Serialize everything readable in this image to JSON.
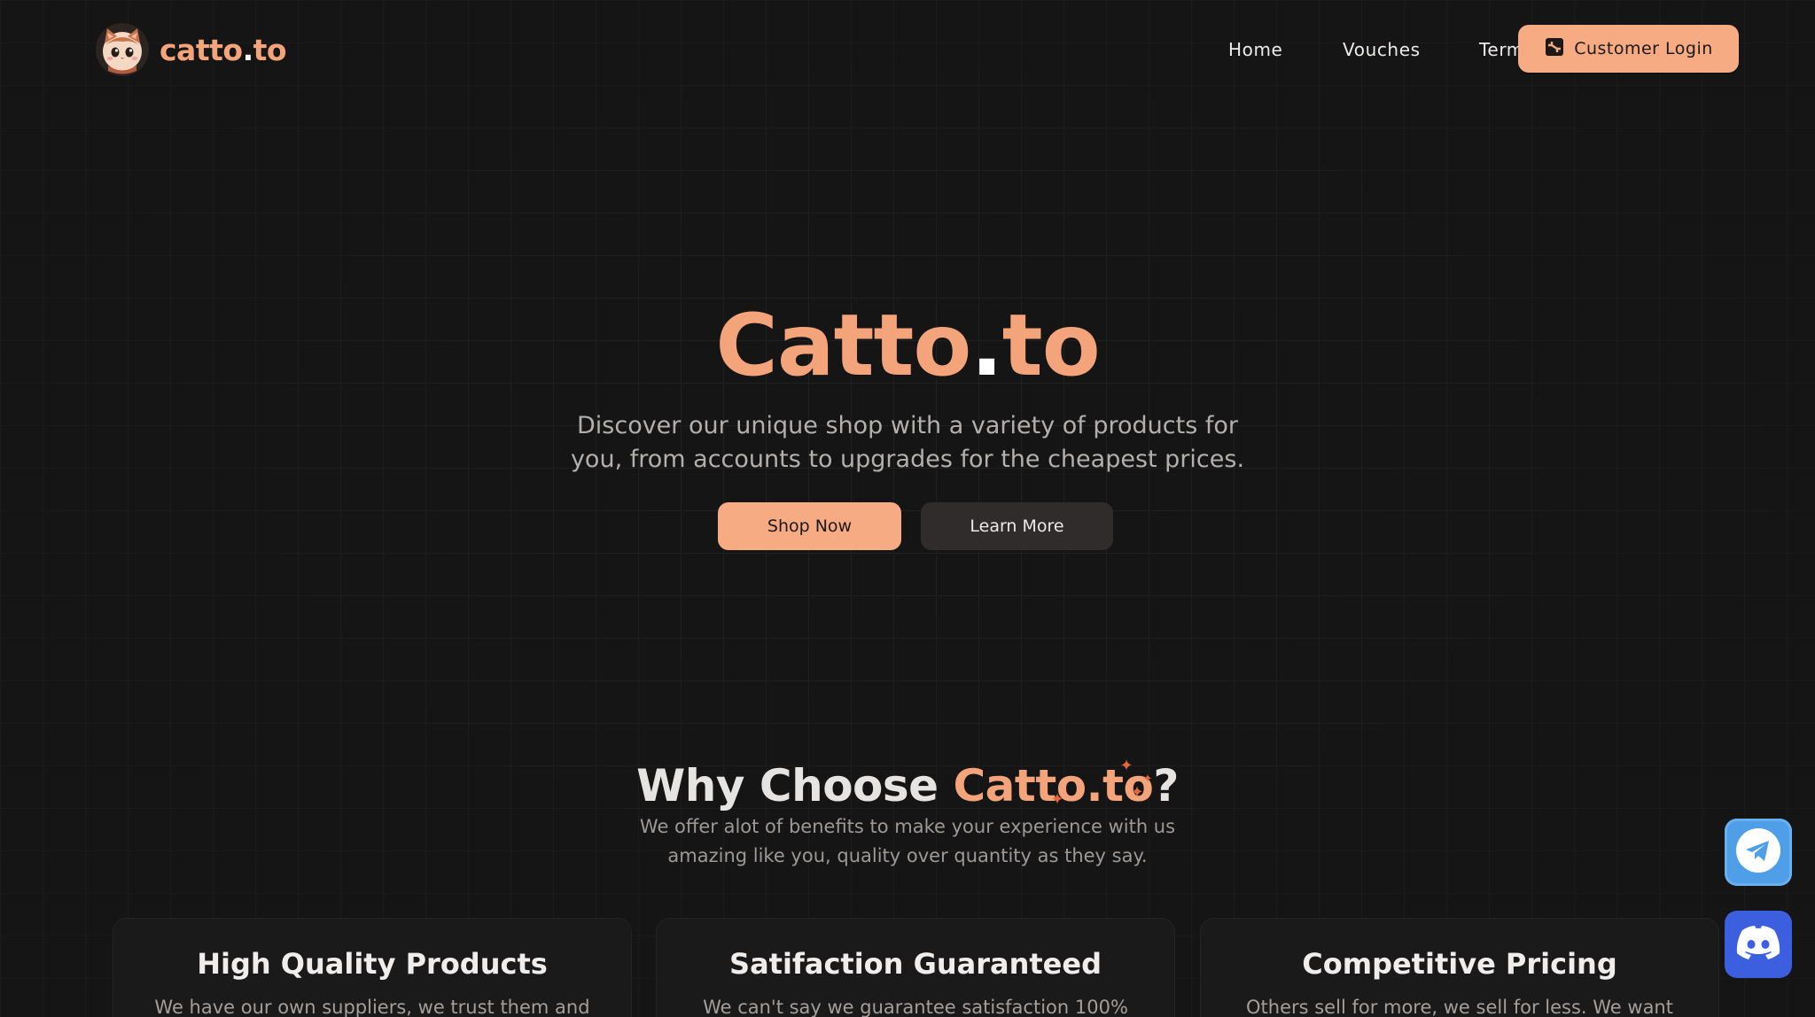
{
  "brand": {
    "name_main": "catto",
    "name_dot": ".",
    "name_tld": "to"
  },
  "nav": {
    "links": [
      "Home",
      "Vouches",
      "Terms"
    ],
    "login_label": "Customer Login"
  },
  "hero": {
    "title_main": "Catto",
    "title_dot": ".",
    "title_tld": "to",
    "subtitle_line1": "Discover our unique shop with a variety of products for",
    "subtitle_line2": "you, from accounts to upgrades for the cheapest prices.",
    "primary_button": "Shop Now",
    "secondary_button": "Learn More"
  },
  "why": {
    "title_prefix": "Why Choose ",
    "title_accent": "Catto.to",
    "title_suffix": "?",
    "subtitle_line1": "We offer alot of benefits to make your experience with us",
    "subtitle_line2": "amazing like you, quality over quantity as they say."
  },
  "features": [
    {
      "title": "High Quality Products",
      "text": "We have our own suppliers, we trust them and"
    },
    {
      "title": "Satifaction Guaranteed",
      "text": "We can't say we guarantee satisfaction 100%"
    },
    {
      "title": "Competitive Pricing",
      "text": "Others sell for more, we sell for less. We want"
    }
  ],
  "social": {
    "telegram_icon": "telegram-icon",
    "discord_icon": "discord-icon"
  },
  "colors": {
    "accent": "#f6ab83",
    "background": "#161515",
    "telegram": "#4f9ee8",
    "discord": "#3c5fe0"
  }
}
